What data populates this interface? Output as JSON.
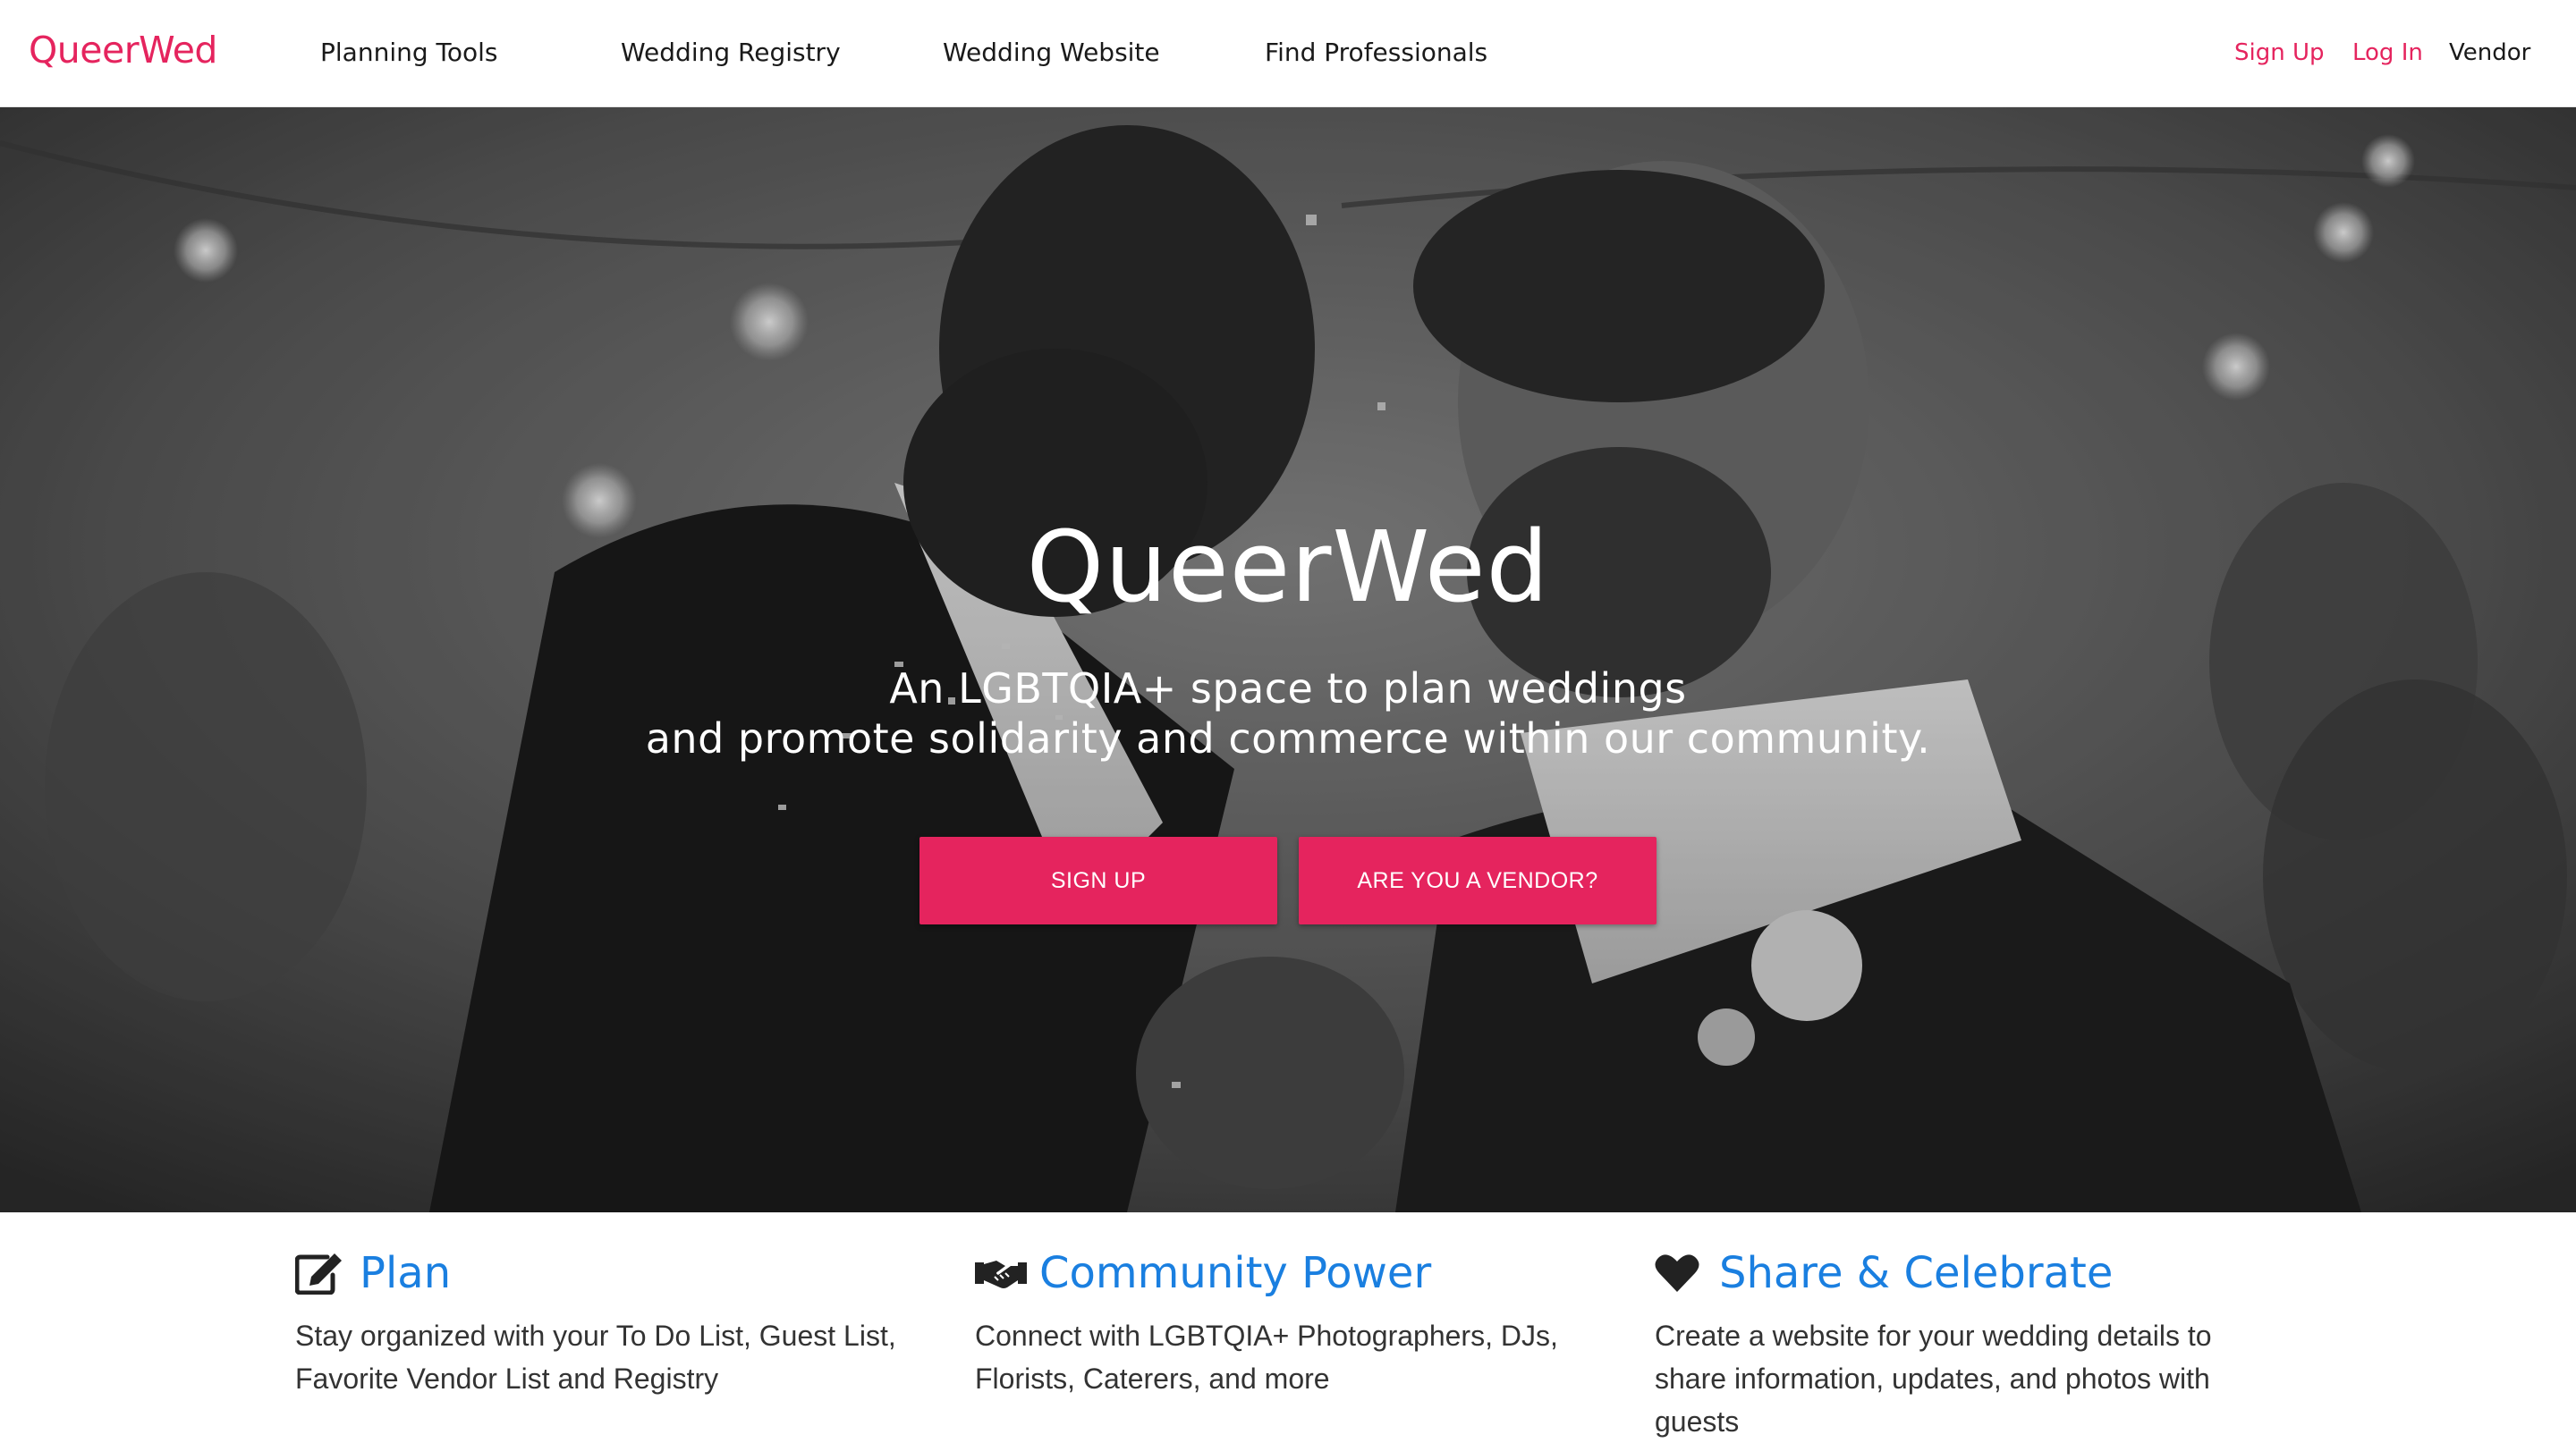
{
  "colors": {
    "brand": "#e5245e",
    "feature_title": "#1a7fe0",
    "nav_text": "#1a1a1a"
  },
  "navbar": {
    "brand": "QueerWed",
    "links": [
      "Planning Tools",
      "Wedding Registry",
      "Wedding Website",
      "Find Professionals"
    ],
    "sign_up": "Sign Up",
    "log_in": "Log In",
    "vendor": "Vendor"
  },
  "hero": {
    "title": "QueerWed",
    "tagline_line1": "An LGBTQIA+ space to plan weddings",
    "tagline_line2": "and promote solidarity and commerce within our community.",
    "signup_button": "SIGN UP",
    "vendor_button": "ARE YOU A VENDOR?",
    "background_image": "black-and-white photo of two grooms dancing"
  },
  "features": [
    {
      "icon": "edit-icon",
      "title": "Plan",
      "text": "Stay organized with your To Do List, Guest List, Favorite Vendor List and Registry"
    },
    {
      "icon": "handshake-icon",
      "title": "Community Power",
      "text": "Connect with LGBTQIA+ Photographers, DJs, Florists, Caterers, and more"
    },
    {
      "icon": "heart-icon",
      "title": "Share & Celebrate",
      "text": "Create a website for your wedding details to share information, updates, and photos with guests"
    }
  ]
}
